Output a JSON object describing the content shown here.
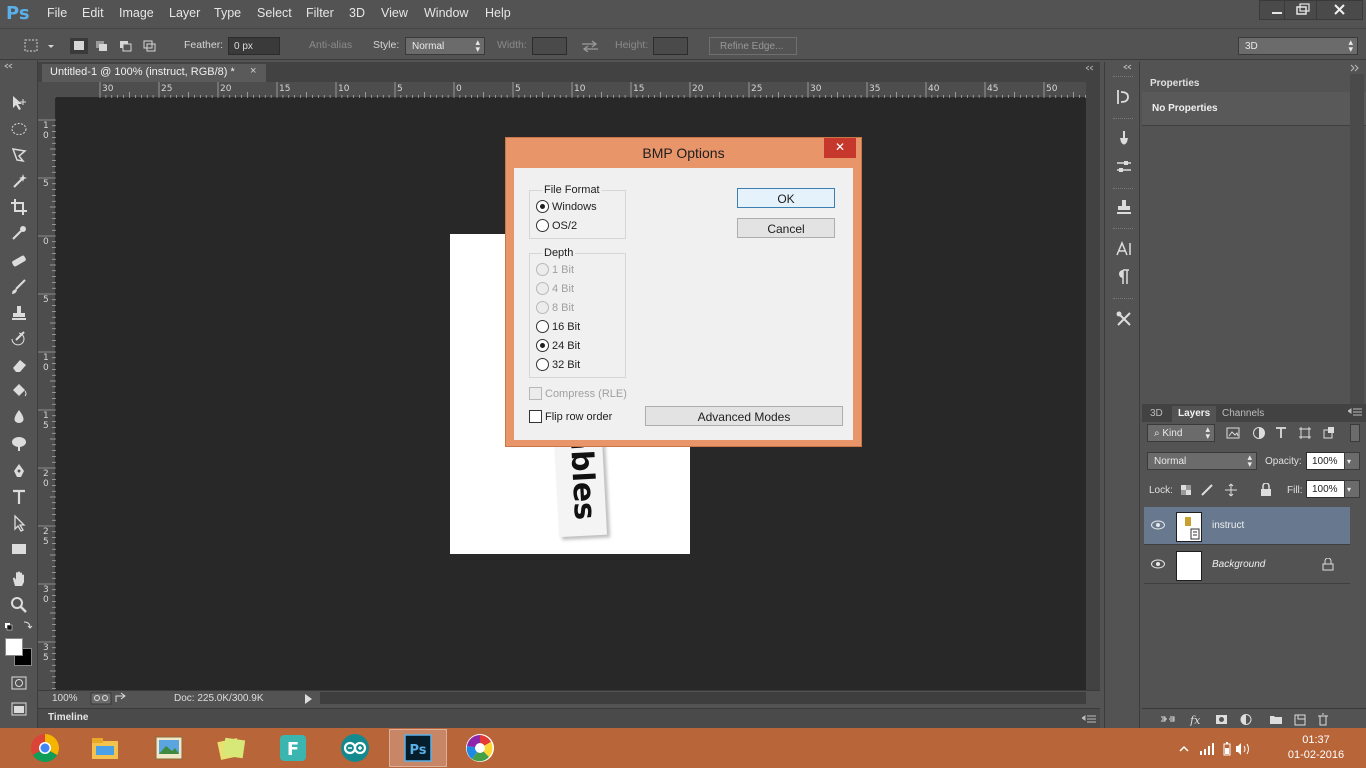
{
  "app": {
    "logo": "Ps",
    "menu": [
      "File",
      "Edit",
      "Image",
      "Layer",
      "Type",
      "Select",
      "Filter",
      "3D",
      "View",
      "Window",
      "Help"
    ],
    "window_controls": [
      "minimize-icon",
      "restore-icon",
      "close-icon"
    ]
  },
  "options_bar": {
    "feather_label": "Feather:",
    "feather_value": "0 px",
    "anti_alias_label": "Anti-alias",
    "style_label": "Style:",
    "style_value": "Normal",
    "width_label": "Width:",
    "height_label": "Height:",
    "refine_edge_label": "Refine Edge...",
    "workspace_value": "3D"
  },
  "document": {
    "tab_title": "Untitled-1 @ 100% (instruct, RGB/8) *",
    "tab_close": "×",
    "ruler_h_labels": [
      "30",
      "25",
      "20",
      "15",
      "10",
      "5",
      "0",
      "5",
      "10",
      "15",
      "20",
      "25",
      "30",
      "35",
      "40",
      "45",
      "50"
    ],
    "ruler_v_labels": [
      "1\n0",
      "5",
      "0",
      "5",
      "1\n0",
      "1\n5",
      "2\n0",
      "2\n5",
      "3\n0",
      "3\n5"
    ],
    "image_text": "ables",
    "zoom": "100%",
    "doc_info": "Doc: 225.0K/300.9K",
    "timeline_label": "Timeline"
  },
  "properties_panel": {
    "tab_label": "Properties",
    "header": "No Properties"
  },
  "layers_panel": {
    "tabs": [
      "3D",
      "Layers",
      "Channels"
    ],
    "active_tab": "Layers",
    "filter_kind": "Kind",
    "blend_mode": "Normal",
    "opacity_label": "Opacity:",
    "opacity_value": "100%",
    "lock_label": "Lock:",
    "fill_label": "Fill:",
    "fill_value": "100%",
    "layers": [
      {
        "name": "instruct",
        "selected": true,
        "italic": false
      },
      {
        "name": "Background",
        "selected": false,
        "italic": true,
        "locked": true
      }
    ]
  },
  "dialog": {
    "title": "BMP Options",
    "close": "✕",
    "file_format_label": "File Format",
    "file_format_options": [
      {
        "label": "Windows",
        "checked": true,
        "disabled": false
      },
      {
        "label": "OS/2",
        "checked": false,
        "disabled": false
      }
    ],
    "depth_label": "Depth",
    "depth_options": [
      {
        "label": "1 Bit",
        "checked": false,
        "disabled": true
      },
      {
        "label": "4 Bit",
        "checked": false,
        "disabled": true
      },
      {
        "label": "8 Bit",
        "checked": false,
        "disabled": true
      },
      {
        "label": "16 Bit",
        "checked": false,
        "disabled": false
      },
      {
        "label": "24 Bit",
        "checked": true,
        "disabled": false
      },
      {
        "label": "32 Bit",
        "checked": false,
        "disabled": false
      }
    ],
    "compress_label": "Compress (RLE)",
    "flip_row_label": "Flip row order",
    "ok_label": "OK",
    "cancel_label": "Cancel",
    "advanced_label": "Advanced Modes"
  },
  "taskbar": {
    "apps": [
      "chrome-icon",
      "file-explorer-icon",
      "photo-viewer-icon",
      "sticky-notes-icon",
      "f-app-icon",
      "arduino-icon",
      "photoshop-icon",
      "picasa-icon"
    ],
    "time": "01:37",
    "date": "01-02-2016"
  },
  "colors": {
    "accent_ps": "#5ab0e8",
    "dialog_frame": "#e9956a",
    "taskbar": "#b8653a",
    "selected_layer": "#68788f"
  }
}
